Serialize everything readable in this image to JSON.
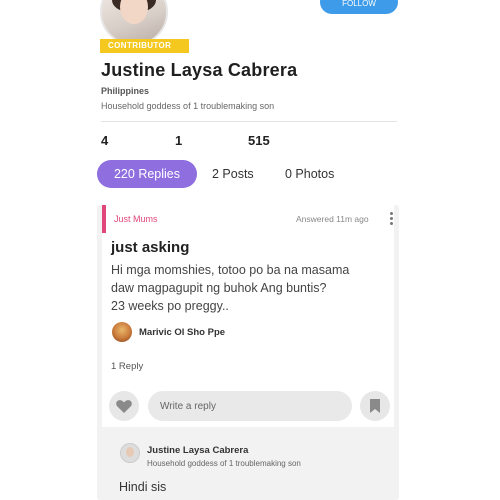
{
  "profile": {
    "follow_label": "FOLLOW",
    "badge": "CONTRIBUTOR",
    "name": "Justine  Laysa Cabrera",
    "country": "Philippines",
    "bio": "Household goddess of 1 troublemaking son"
  },
  "stats": [
    "4",
    "1",
    "515"
  ],
  "tabs": [
    {
      "label": "220 Replies",
      "active": true
    },
    {
      "label": "2 Posts",
      "active": false
    },
    {
      "label": "0 Photos",
      "active": false
    }
  ],
  "post": {
    "category": "Just Mums",
    "answered": "Answered 11m ago",
    "title": "just asking",
    "body_lines": [
      "Hi mga momshies, totoo po ba na masama",
      "daw magpagupit ng buhok Ang buntis?",
      "23 weeks po preggy.."
    ],
    "author": "Marivic Ol Sho Ppe",
    "reply_count": "1 Reply",
    "reply_placeholder": "Write a reply"
  },
  "reply": {
    "author": "Justine  Laysa Cabrera",
    "bio": "Household goddess of 1 troublemaking son",
    "text": "Hindi sis"
  },
  "colors": {
    "accent_purple": "#8f6ee0",
    "follow_blue": "#3d9be9",
    "badge_yellow": "#f4c81e",
    "category_pink": "#e0487a"
  },
  "icons": [
    "heart-icon",
    "bookmark-icon",
    "more-vertical-icon"
  ]
}
